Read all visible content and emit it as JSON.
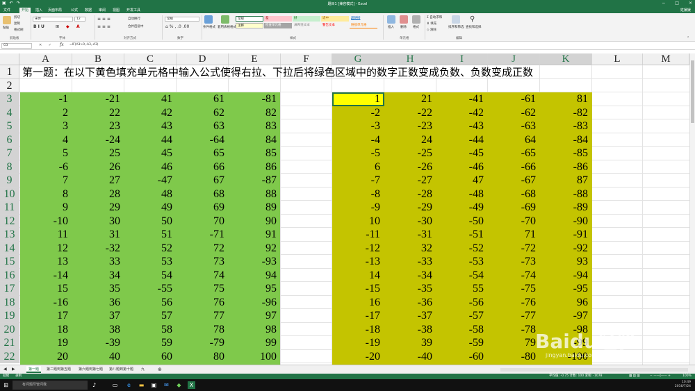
{
  "window": {
    "title": "题目1 [兼容模式] - Excel",
    "qat_icons": [
      "save-icon",
      "undo-icon",
      "redo-icon"
    ],
    "user": "姓媛媛",
    "controls": [
      "−",
      "□",
      "×"
    ]
  },
  "ribbon_tabs": [
    "文件",
    "开始",
    "插入",
    "页面布局",
    "公式",
    "数据",
    "审阅",
    "视图",
    "开发工具"
  ],
  "ribbon": {
    "clipboard": {
      "paste": "粘贴",
      "cut": "剪切",
      "copy": "复制",
      "format_painter": "格式刷",
      "group": "剪贴板"
    },
    "font": {
      "name": "宋体",
      "size": "12",
      "group": "字体"
    },
    "alignment": {
      "wrap": "自动换行",
      "merge": "合并后居中",
      "group": "对齐方式"
    },
    "number": {
      "format": "常规",
      "group": "数字"
    },
    "styles": {
      "conditional": "条件格式",
      "table": "套用表格格式",
      "cells": [
        "常规",
        "差",
        "好",
        "适中",
        "超链接",
        "注释",
        "检查单元格",
        "解释性文本",
        "警告文本",
        "链接单元格"
      ],
      "group": "样式"
    },
    "cells": {
      "insert": "插入",
      "delete": "删除",
      "format": "格式",
      "group": "单元格"
    },
    "editing": {
      "autosum": "自动求和",
      "fill": "填充",
      "clear": "清除",
      "sort": "排序和筛选",
      "find": "查找和选择",
      "group": "编辑"
    }
  },
  "formula_bar": {
    "name_box": "G3",
    "formula": "=IF(A3>0,-A3,-A3)"
  },
  "columns": [
    "A",
    "B",
    "C",
    "D",
    "E",
    "F",
    "G",
    "H",
    "I",
    "J",
    "K",
    "L",
    "M"
  ],
  "rows": [
    "1",
    "2",
    "3",
    "4",
    "5",
    "6",
    "7",
    "8",
    "9",
    "10",
    "11",
    "12",
    "13",
    "14",
    "15",
    "16",
    "17",
    "18",
    "19",
    "20",
    "21",
    "22"
  ],
  "headline": "第一题：在以下黄色填充单元格中输入公式使得右拉、下拉后将绿色区域中的数字正数变成负数、负数变成正数",
  "green_data": [
    [
      "-1",
      "-21",
      "41",
      "61",
      "-81"
    ],
    [
      "2",
      "22",
      "42",
      "62",
      "82"
    ],
    [
      "3",
      "23",
      "43",
      "63",
      "83"
    ],
    [
      "4",
      "-24",
      "44",
      "-64",
      "84"
    ],
    [
      "5",
      "25",
      "45",
      "65",
      "85"
    ],
    [
      "-6",
      "26",
      "46",
      "66",
      "86"
    ],
    [
      "7",
      "27",
      "-47",
      "67",
      "-87"
    ],
    [
      "8",
      "28",
      "48",
      "68",
      "88"
    ],
    [
      "9",
      "29",
      "49",
      "69",
      "89"
    ],
    [
      "-10",
      "30",
      "50",
      "70",
      "90"
    ],
    [
      "11",
      "31",
      "51",
      "-71",
      "91"
    ],
    [
      "12",
      "-32",
      "52",
      "72",
      "92"
    ],
    [
      "13",
      "33",
      "53",
      "73",
      "-93"
    ],
    [
      "-14",
      "34",
      "54",
      "74",
      "94"
    ],
    [
      "15",
      "35",
      "-55",
      "75",
      "95"
    ],
    [
      "-16",
      "36",
      "56",
      "76",
      "-96"
    ],
    [
      "17",
      "37",
      "57",
      "77",
      "97"
    ],
    [
      "18",
      "38",
      "58",
      "78",
      "98"
    ],
    [
      "19",
      "-39",
      "59",
      "-79",
      "99"
    ],
    [
      "20",
      "40",
      "60",
      "80",
      "100"
    ]
  ],
  "olive_data": [
    [
      "1",
      "21",
      "-41",
      "-61",
      "81"
    ],
    [
      "-2",
      "-22",
      "-42",
      "-62",
      "-82"
    ],
    [
      "-3",
      "-23",
      "-43",
      "-63",
      "-83"
    ],
    [
      "-4",
      "24",
      "-44",
      "64",
      "-84"
    ],
    [
      "-5",
      "-25",
      "-45",
      "-65",
      "-85"
    ],
    [
      "6",
      "-26",
      "-46",
      "-66",
      "-86"
    ],
    [
      "-7",
      "-27",
      "47",
      "-67",
      "87"
    ],
    [
      "-8",
      "-28",
      "-48",
      "-68",
      "-88"
    ],
    [
      "-9",
      "-29",
      "-49",
      "-69",
      "-89"
    ],
    [
      "10",
      "-30",
      "-50",
      "-70",
      "-90"
    ],
    [
      "-11",
      "-31",
      "-51",
      "71",
      "-91"
    ],
    [
      "-12",
      "32",
      "-52",
      "-72",
      "-92"
    ],
    [
      "-13",
      "-33",
      "-53",
      "-73",
      "93"
    ],
    [
      "14",
      "-34",
      "-54",
      "-74",
      "-94"
    ],
    [
      "-15",
      "-35",
      "55",
      "-75",
      "-95"
    ],
    [
      "16",
      "-36",
      "-56",
      "-76",
      "96"
    ],
    [
      "-17",
      "-37",
      "-57",
      "-77",
      "-97"
    ],
    [
      "-18",
      "-38",
      "-58",
      "-78",
      "-98"
    ],
    [
      "-19",
      "39",
      "-59",
      "79",
      "-99"
    ],
    [
      "-20",
      "-40",
      "-60",
      "-80",
      "-100"
    ]
  ],
  "sheet_tabs": [
    "第一题",
    "第二题到第五题",
    "第六题到第七题",
    "第八题到第十题",
    "九"
  ],
  "status": {
    "mode": "就绪",
    "macro": "录制",
    "stats": "平均值: -0.75    计数: 100    求和: -1078",
    "zoom": "100%"
  },
  "taskbar": {
    "search_placeholder": "有问题尽管问我",
    "time": "10:49",
    "date": "2016/7/24"
  },
  "watermark": {
    "brand": "Baidu经验",
    "url": "jingyan.baidu.com"
  },
  "colors": {
    "excel_green": "#217346",
    "green_fill": "#7fc94b",
    "olive_fill": "#c4c400",
    "yellow_fill": "#ffff00"
  }
}
